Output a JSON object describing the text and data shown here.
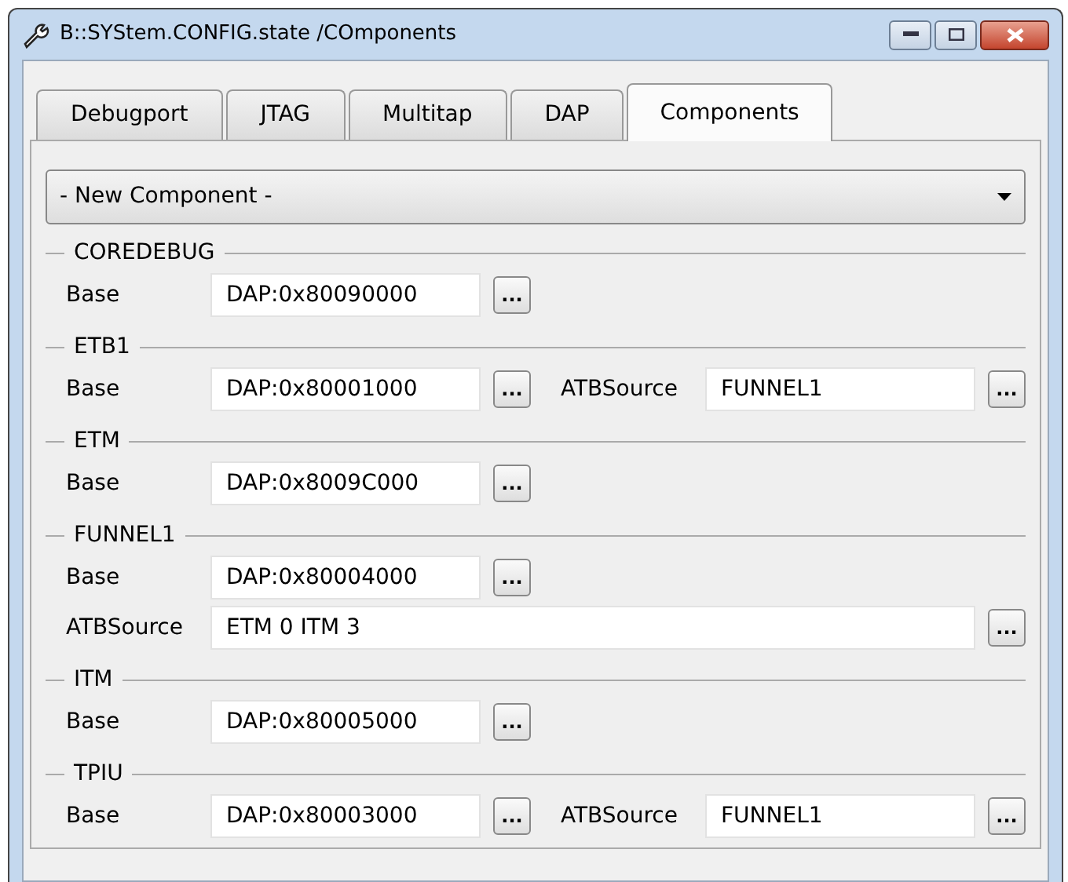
{
  "window": {
    "title": "B::SYStem.CONFIG.state /COmponents"
  },
  "tabs": [
    {
      "label": "Debugport",
      "selected": false
    },
    {
      "label": "JTAG",
      "selected": false
    },
    {
      "label": "Multitap",
      "selected": false
    },
    {
      "label": "DAP",
      "selected": false
    },
    {
      "label": "Components",
      "selected": true
    }
  ],
  "dropdown": {
    "value": "- New Component -"
  },
  "groups": [
    {
      "title": "COREDEBUG",
      "rows": [
        [
          {
            "kind": "short",
            "label": "Base",
            "value": "DAP:0x80090000",
            "button": "..."
          }
        ]
      ]
    },
    {
      "title": "ETB1",
      "rows": [
        [
          {
            "kind": "short",
            "label": "Base",
            "value": "DAP:0x80001000",
            "button": "..."
          },
          {
            "kind": "short",
            "label": "ATBSource",
            "value": "FUNNEL1",
            "button": "..."
          }
        ]
      ]
    },
    {
      "title": "ETM",
      "rows": [
        [
          {
            "kind": "short",
            "label": "Base",
            "value": "DAP:0x8009C000",
            "button": "..."
          }
        ]
      ]
    },
    {
      "title": "FUNNEL1",
      "rows": [
        [
          {
            "kind": "short",
            "label": "Base",
            "value": "DAP:0x80004000",
            "button": "..."
          }
        ],
        [
          {
            "kind": "wide",
            "label": "ATBSource",
            "value": "ETM 0 ITM 3",
            "button": "..."
          }
        ]
      ]
    },
    {
      "title": "ITM",
      "rows": [
        [
          {
            "kind": "short",
            "label": "Base",
            "value": "DAP:0x80005000",
            "button": "..."
          }
        ]
      ]
    },
    {
      "title": "TPIU",
      "rows": [
        [
          {
            "kind": "short",
            "label": "Base",
            "value": "DAP:0x80003000",
            "button": "..."
          },
          {
            "kind": "short",
            "label": "ATBSource",
            "value": "FUNNEL1",
            "button": "..."
          }
        ]
      ]
    }
  ]
}
